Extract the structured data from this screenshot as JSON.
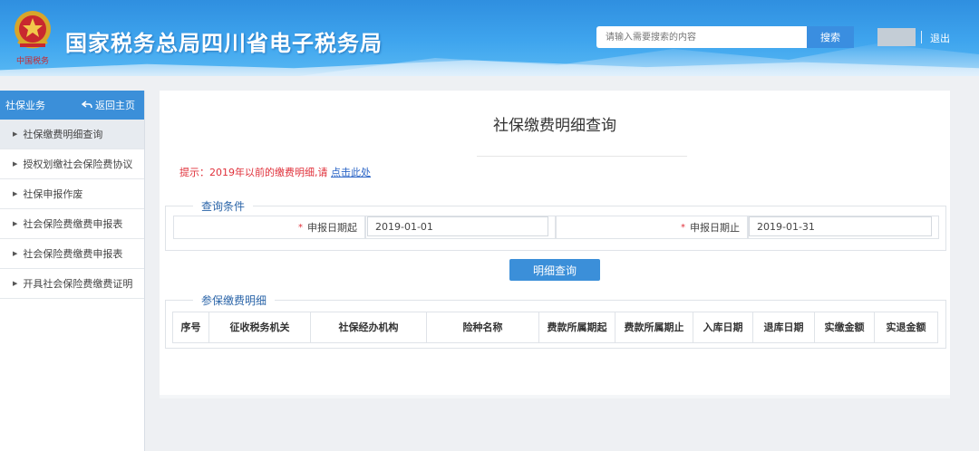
{
  "header": {
    "emblem_text": "中国税务",
    "site_title": "国家税务总局四川省电子税务局",
    "search_placeholder": "请输入需要搜索的内容",
    "search_label": "搜索",
    "logout_label": "退出"
  },
  "sidebar": {
    "title": "社保业务",
    "back_label": "返回主页",
    "items": [
      {
        "label": "社保缴费明细查询",
        "active": true
      },
      {
        "label": "授权划缴社会保险费协议",
        "active": false
      },
      {
        "label": "社保申报作废",
        "active": false
      },
      {
        "label": "社会保险费缴费申报表",
        "active": false
      },
      {
        "label": "社会保险费缴费申报表",
        "active": false
      },
      {
        "label": "开具社会保险费缴费证明",
        "active": false
      }
    ]
  },
  "main": {
    "page_title": "社保缴费明细查询",
    "tip_text": "提示：2019年以前的缴费明细,请 ",
    "tip_link": "点击此处",
    "query_section": {
      "legend": "查询条件",
      "start_label": "申报日期起",
      "start_value": "2019-01-01",
      "end_label": "申报日期止",
      "end_value": "2019-01-31",
      "required_mark": "*"
    },
    "query_button": "明细查询",
    "detail_section": {
      "legend": "参保缴费明细",
      "columns": [
        "序号",
        "征收税务机关",
        "社保经办机构",
        "险种名称",
        "费款所属期起",
        "费款所属期止",
        "入库日期",
        "退库日期",
        "实缴金额",
        "实退金额"
      ]
    }
  },
  "colors": {
    "header_blue": "#3fa5ee",
    "accent": "#3b8fd9",
    "tip_red": "#e0313b",
    "legend_blue": "#2a64a8"
  }
}
